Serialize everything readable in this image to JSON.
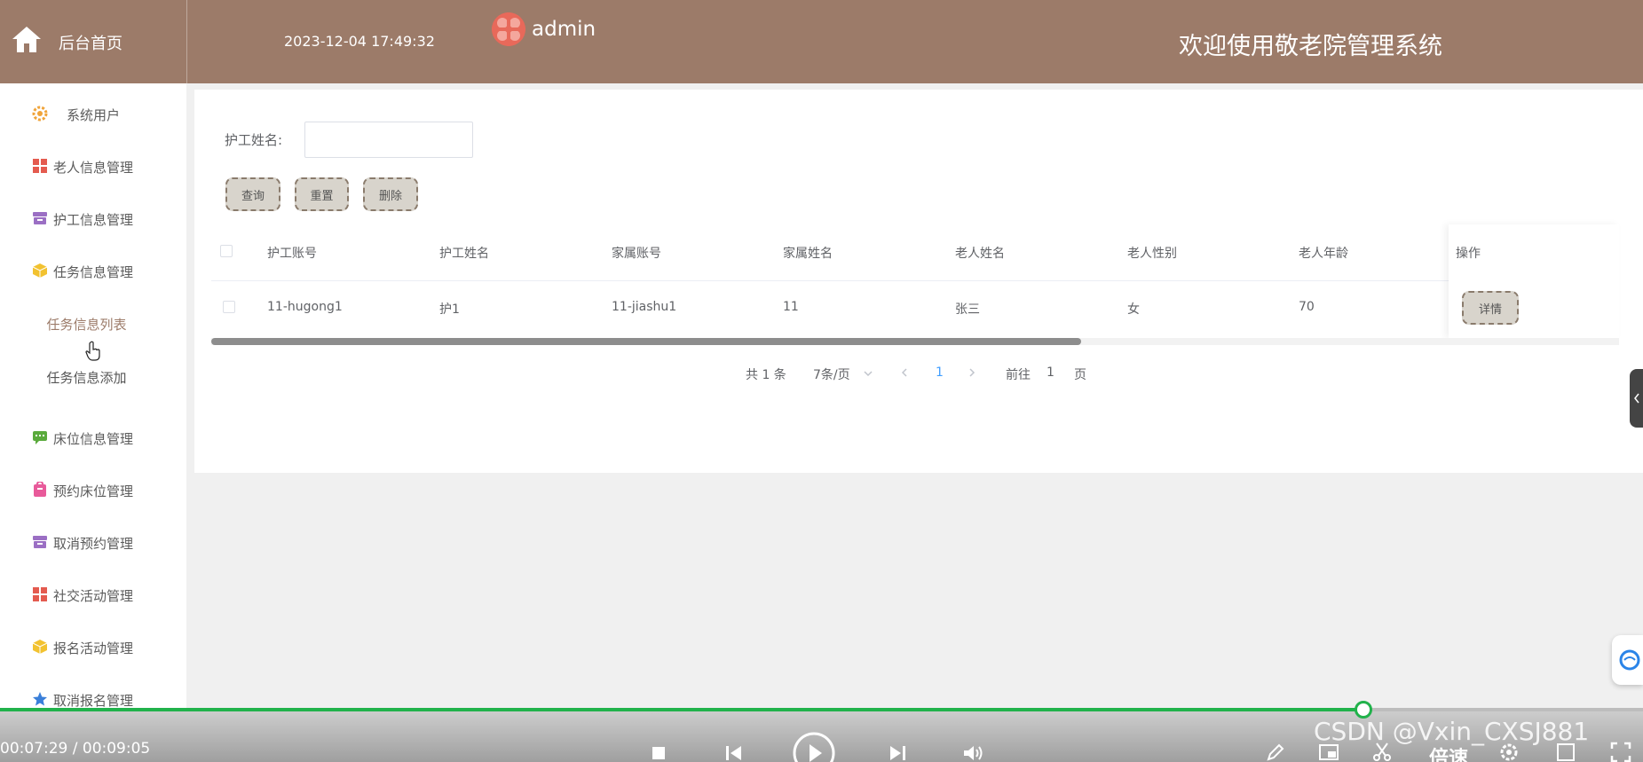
{
  "header": {
    "home_label": "后台首页",
    "datetime": "2023-12-04 17:49:32",
    "username": "admin",
    "welcome": "欢迎使用敬老院管理系统",
    "bg_color": "#9c7b69"
  },
  "sidebar": {
    "items": [
      {
        "label": "系统用户",
        "icon": "gear-icon",
        "color": "#f0a43a"
      },
      {
        "label": "老人信息管理",
        "icon": "grid-icon",
        "color": "#e45b4f"
      },
      {
        "label": "护工信息管理",
        "icon": "archive-icon",
        "color": "#9b6fc4"
      },
      {
        "label": "任务信息管理",
        "icon": "cube-icon",
        "color": "#f2c230"
      },
      {
        "label": "床位信息管理",
        "icon": "message-icon",
        "color": "#5aaa3c"
      },
      {
        "label": "预约床位管理",
        "icon": "bag-icon",
        "color": "#e85a9a"
      },
      {
        "label": "取消预约管理",
        "icon": "archive-icon",
        "color": "#9b6fc4"
      },
      {
        "label": "社交活动管理",
        "icon": "grid-icon",
        "color": "#e45b4f"
      },
      {
        "label": "报名活动管理",
        "icon": "cube-icon",
        "color": "#f2c230"
      },
      {
        "label": "取消报名管理",
        "icon": "star-icon",
        "color": "#3a7fd9"
      }
    ],
    "sub_items": [
      {
        "label": "任务信息列表",
        "active": true
      },
      {
        "label": "任务信息添加",
        "active": false
      }
    ]
  },
  "search": {
    "label": "护工姓名:",
    "value": "",
    "placeholder": ""
  },
  "buttons": {
    "query": "查询",
    "reset": "重置",
    "delete": "删除"
  },
  "table": {
    "columns": [
      "护工账号",
      "护工姓名",
      "家属账号",
      "家属姓名",
      "老人姓名",
      "老人性别",
      "老人年龄",
      "操作"
    ],
    "rows": [
      [
        "11-hugong1",
        "护1",
        "11-jiashu1",
        "11",
        "张三",
        "女",
        "70"
      ]
    ],
    "detail_button": "详情"
  },
  "pagination": {
    "total": "共 1 条",
    "page_size": "7条/页",
    "current": "1",
    "goto_prefix": "前往",
    "goto_value": "1",
    "goto_suffix": "页"
  },
  "video": {
    "time": "00:07:29 / 00:09:05",
    "progress": 0.83,
    "speed_label": "倍速",
    "watermark": "CSDN @Vxin_CXSJ881"
  }
}
